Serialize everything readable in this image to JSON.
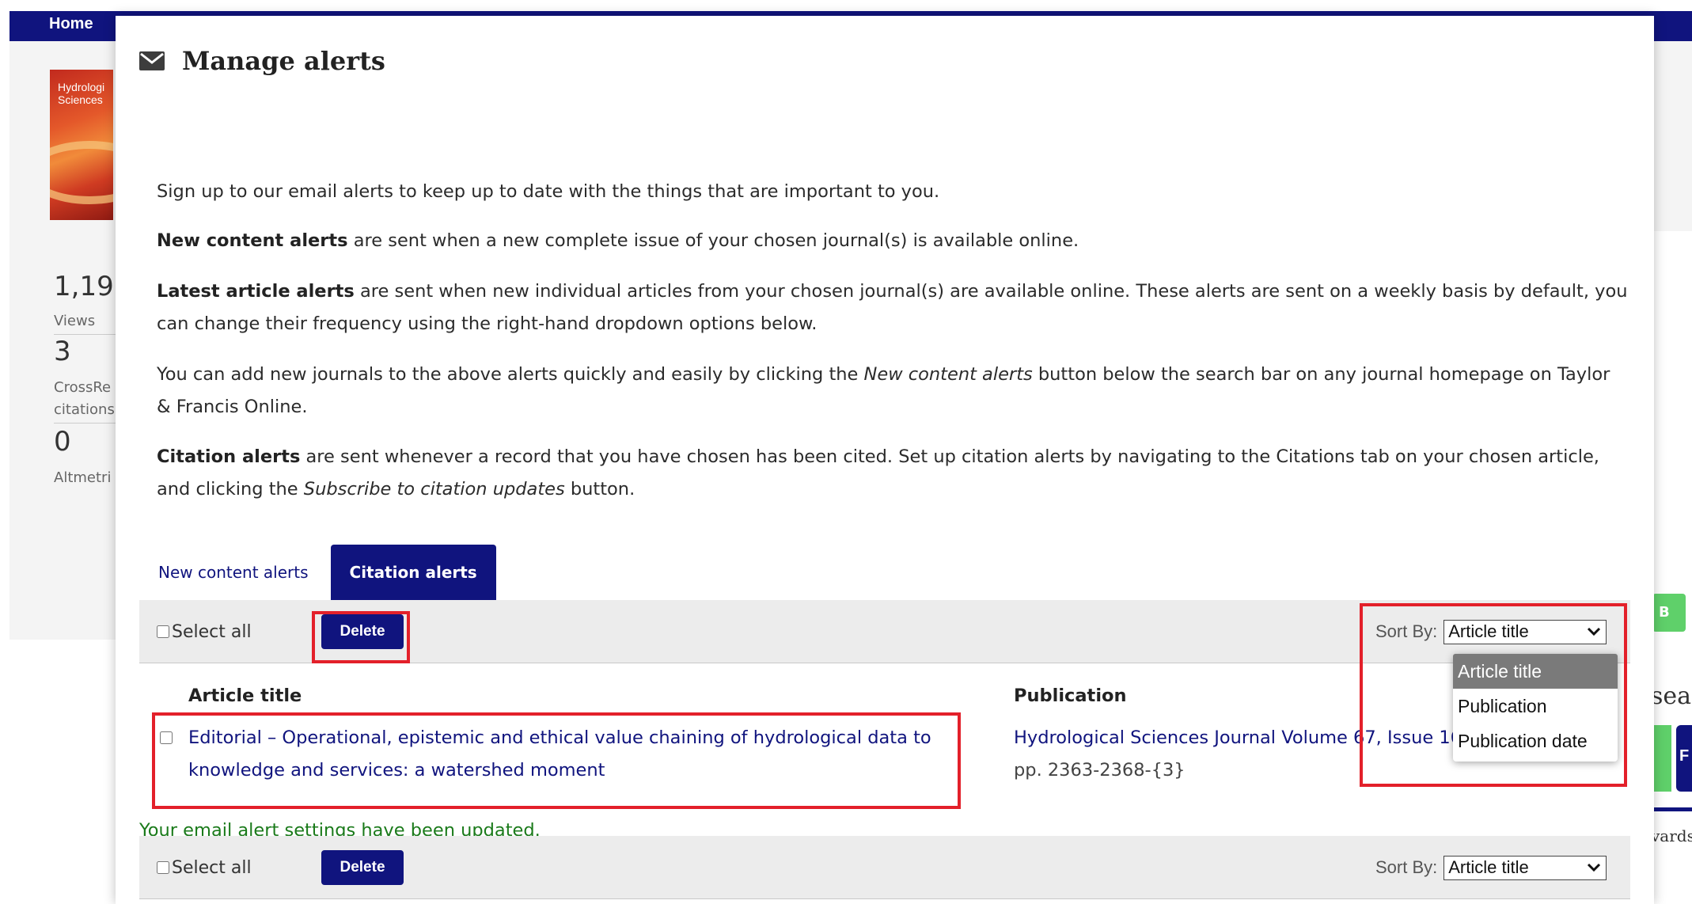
{
  "background_page": {
    "nav_home": "Home",
    "cover_title": "Hydrologi Sciences",
    "metrics": {
      "views_value": "1,19",
      "views_label": "Views",
      "crossref_value": "3",
      "crossref_label_1": "CrossRe",
      "crossref_label_2": "citations",
      "altmetric_value": "0",
      "altmetric_label": "Altmetri"
    },
    "right_chip": "B",
    "right_text_1": "sear",
    "right_text_2": "vards",
    "right_block_letter": "F"
  },
  "modal": {
    "title": "Manage alerts",
    "title_icon": "envelope-icon",
    "intro": "Sign up to our email alerts to keep up to date with the things that are important to you.",
    "new_content": {
      "bold": "New content alerts",
      "text": " are sent when a new complete issue of your chosen journal(s) is available online."
    },
    "latest_article": {
      "bold": "Latest article alerts",
      "text": " are sent when new individual articles from your chosen journal(s) are available online. These alerts are sent on a weekly basis by default, you can change their frequency using the right-hand dropdown options below."
    },
    "add_journals": {
      "pre": "You can add new journals to the above alerts quickly and easily by clicking the ",
      "italic": "New content alerts",
      "post": " button below the search bar on any journal homepage on Taylor & Francis Online."
    },
    "citation_para": {
      "bold": "Citation alerts",
      "pre": " are sent whenever a record that you have chosen has been cited. Set up citation alerts by navigating to the Citations tab on your chosen article, and clicking the ",
      "italic": "Subscribe to citation updates",
      "post": " button."
    },
    "tabs": [
      {
        "label": "New content alerts",
        "active": false
      },
      {
        "label": "Citation alerts",
        "active": true
      }
    ],
    "toolbar": {
      "select_all": "Select all",
      "delete": "Delete",
      "sort_by": "Sort By:",
      "sort_value": "Article title"
    },
    "sort_options": [
      "Article title",
      "Publication",
      "Publication date"
    ],
    "table": {
      "col_article": "Article title",
      "col_publication": "Publication",
      "rows": [
        {
          "article": "Editorial – Operational, epistemic and ethical value chaining of hydrological data to knowledge and services: a watershed moment",
          "publication": "Hydrological Sciences Journal Volume 67, Issue 16",
          "pages": "pp. 2363-2368-{3}"
        }
      ]
    },
    "success_message": "Your email alert settings have been updated.",
    "colors": {
      "navy": "#10147e",
      "success_green": "#1a7a1a",
      "highlight_red": "#e3202a",
      "toolbar_gray": "#ececec"
    }
  }
}
